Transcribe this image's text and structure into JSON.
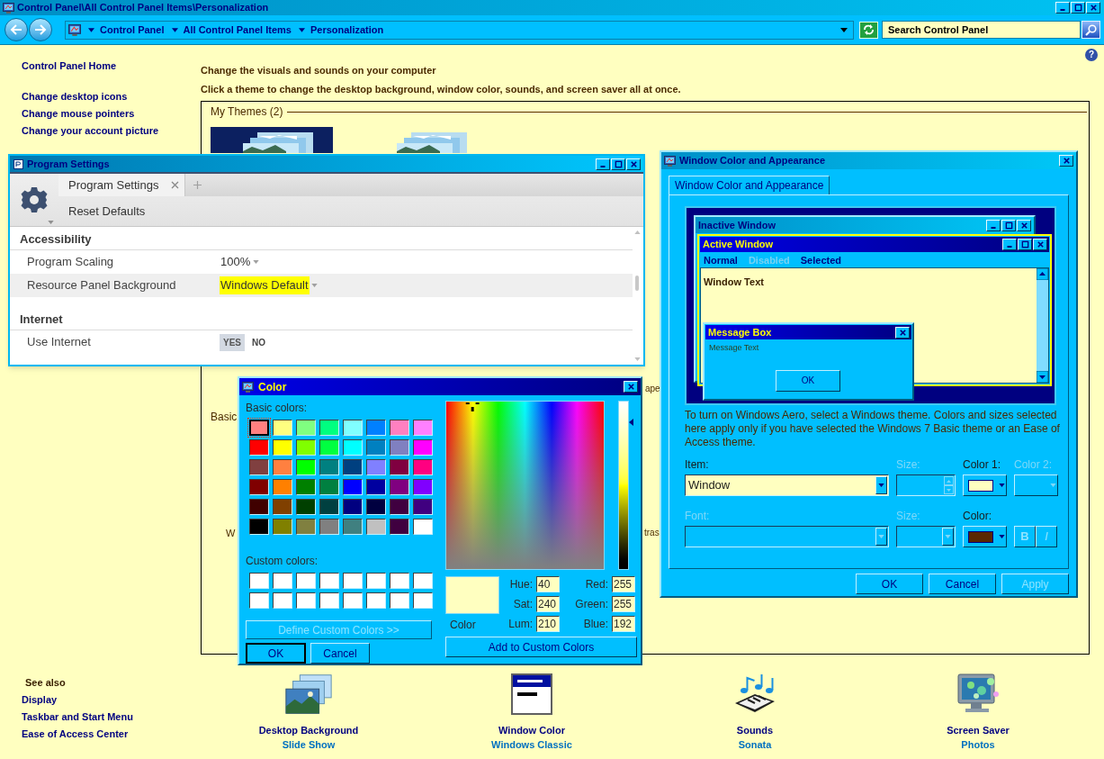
{
  "window": {
    "title": "Control Panel\\All Control Panel Items\\Personalization"
  },
  "address_bar": {
    "breadcrumbs": [
      "Control Panel",
      "All Control Panel Items",
      "Personalization"
    ]
  },
  "search": {
    "placeholder": "Search Control Panel"
  },
  "help": "?",
  "sidebar": {
    "home": "Control Panel Home",
    "links": [
      "Change desktop icons",
      "Change mouse pointers",
      "Change your account picture"
    ],
    "see_also_title": "See also",
    "see_also_links": [
      "Display",
      "Taskbar and Start Menu",
      "Ease of Access Center"
    ]
  },
  "content": {
    "heading": "Change the visuals and sounds on your computer",
    "instructions": "Click a theme to change the desktop background, window color, sounds, and screen saver all at once.",
    "themes_group": "My Themes (2)",
    "partly_hidden_texts": [
      "Basic",
      "W",
      "ape",
      "tras"
    ]
  },
  "settings_bar": [
    {
      "label": "Desktop Background",
      "value": "Slide Show"
    },
    {
      "label": "Window Color",
      "value": "Windows Classic"
    },
    {
      "label": "Sounds",
      "value": "Sonata"
    },
    {
      "label": "Screen Saver",
      "value": "Photos"
    }
  ],
  "program_settings": {
    "title": "Program Settings",
    "tabs": [
      {
        "label": "Program Settings",
        "selected": true
      }
    ],
    "reset": "Reset Defaults",
    "sections": [
      {
        "title": "Accessibility",
        "rows": [
          {
            "kind": "dropdown",
            "label": "Program Scaling",
            "value": "100%",
            "highlighted": false,
            "hovered": false
          },
          {
            "kind": "dropdown",
            "label": "Resource Panel Background",
            "value": "Windows Default",
            "highlighted": true,
            "hovered": true
          }
        ]
      },
      {
        "title": "Internet",
        "rows": [
          {
            "kind": "toggle",
            "label": "Use Internet",
            "hovered": false,
            "options": [
              {
                "label": "YES",
                "selected": true
              },
              {
                "label": "NO",
                "selected": false
              }
            ]
          }
        ]
      }
    ]
  },
  "color_dialog": {
    "title": "Color",
    "basic_label": "Basic colors:",
    "basic_colors": [
      {
        "color": "#ff8080",
        "selected": true
      },
      {
        "color": "#ffff80",
        "selected": false
      },
      {
        "color": "#80ff80",
        "selected": false
      },
      {
        "color": "#00ff80",
        "selected": false
      },
      {
        "color": "#80ffff",
        "selected": false
      },
      {
        "color": "#0080ff",
        "selected": false
      },
      {
        "color": "#ff80c0",
        "selected": false
      },
      {
        "color": "#ff80ff",
        "selected": false
      },
      {
        "color": "#ff0000",
        "selected": false
      },
      {
        "color": "#ffff00",
        "selected": false
      },
      {
        "color": "#80ff00",
        "selected": false
      },
      {
        "color": "#00ff40",
        "selected": false
      },
      {
        "color": "#00ffff",
        "selected": false
      },
      {
        "color": "#0080c0",
        "selected": false
      },
      {
        "color": "#8080c0",
        "selected": false
      },
      {
        "color": "#ff00ff",
        "selected": false
      },
      {
        "color": "#804040",
        "selected": false
      },
      {
        "color": "#ff8040",
        "selected": false
      },
      {
        "color": "#00ff00",
        "selected": false
      },
      {
        "color": "#008080",
        "selected": false
      },
      {
        "color": "#004080",
        "selected": false
      },
      {
        "color": "#8080ff",
        "selected": false
      },
      {
        "color": "#800040",
        "selected": false
      },
      {
        "color": "#ff0080",
        "selected": false
      },
      {
        "color": "#800000",
        "selected": false
      },
      {
        "color": "#ff8000",
        "selected": false
      },
      {
        "color": "#008000",
        "selected": false
      },
      {
        "color": "#008040",
        "selected": false
      },
      {
        "color": "#0000ff",
        "selected": false
      },
      {
        "color": "#0000a0",
        "selected": false
      },
      {
        "color": "#800080",
        "selected": false
      },
      {
        "color": "#8000ff",
        "selected": false
      },
      {
        "color": "#400000",
        "selected": false
      },
      {
        "color": "#804000",
        "selected": false
      },
      {
        "color": "#004000",
        "selected": false
      },
      {
        "color": "#004040",
        "selected": false
      },
      {
        "color": "#000080",
        "selected": false
      },
      {
        "color": "#000040",
        "selected": false
      },
      {
        "color": "#400040",
        "selected": false
      },
      {
        "color": "#400080",
        "selected": false
      },
      {
        "color": "#000000",
        "selected": false
      },
      {
        "color": "#808000",
        "selected": false
      },
      {
        "color": "#808040",
        "selected": false
      },
      {
        "color": "#808080",
        "selected": false
      },
      {
        "color": "#408080",
        "selected": false
      },
      {
        "color": "#c0c0c0",
        "selected": false
      },
      {
        "color": "#400040",
        "selected": false
      },
      {
        "color": "#ffffff",
        "selected": false
      }
    ],
    "custom_label": "Custom colors:",
    "custom_colors": [
      {
        "color": "#ffffff"
      },
      {
        "color": "#ffffff"
      },
      {
        "color": "#ffffff"
      },
      {
        "color": "#ffffff"
      },
      {
        "color": "#ffffff"
      },
      {
        "color": "#ffffff"
      },
      {
        "color": "#ffffff"
      },
      {
        "color": "#ffffff"
      },
      {
        "color": "#ffffff"
      },
      {
        "color": "#ffffff"
      },
      {
        "color": "#ffffff"
      },
      {
        "color": "#ffffff"
      },
      {
        "color": "#ffffff"
      },
      {
        "color": "#ffffff"
      },
      {
        "color": "#ffffff"
      },
      {
        "color": "#ffffff"
      }
    ],
    "define_button": {
      "label": "Define Custom Colors >>",
      "disabled": true
    },
    "ok": "OK",
    "cancel": "Cancel",
    "luminance_slider": {
      "level": 0.875
    },
    "preview": {
      "color": "#ffffc0",
      "label": "Color"
    },
    "fields": [
      {
        "label": "Hue:",
        "value": "40"
      },
      {
        "label": "Red:",
        "value": "255"
      },
      {
        "label": "Sat:",
        "value": "240"
      },
      {
        "label": "Green:",
        "value": "255"
      },
      {
        "label": "Lum:",
        "value": "210"
      },
      {
        "label": "Blue:",
        "value": "192"
      }
    ],
    "add_button": "Add to Custom Colors"
  },
  "appearance_dialog": {
    "title": "Window Color and Appearance",
    "tabs": [
      {
        "label": "Window Color and Appearance",
        "selected": true
      }
    ],
    "preview": {
      "inactive_title": "Inactive Window",
      "active_title": "Active Window",
      "menu": [
        {
          "label": "Normal",
          "disabled": false
        },
        {
          "label": "Disabled",
          "disabled": true
        },
        {
          "label": "Selected",
          "disabled": false
        }
      ],
      "window_text": "Window Text",
      "message_title": "Message Box",
      "message_text": "Message Text",
      "message_ok": "OK"
    },
    "description": "To turn on Windows Aero, select a Windows theme.  Colors and sizes selected here apply only if you have selected the Windows 7 Basic theme or an Ease of Access theme.",
    "controls": [
      {
        "kind": "select",
        "label": "Item:",
        "value": "Window",
        "disabled": false
      },
      {
        "kind": "spinner",
        "label": "Size:",
        "disabled": true
      },
      {
        "kind": "color",
        "label": "Color 1:",
        "color": "#ffffc0",
        "disabled": false
      },
      {
        "kind": "color",
        "label": "Color 2:",
        "disabled": true
      },
      {
        "kind": "select",
        "label": "Font:",
        "disabled": true
      },
      {
        "kind": "select",
        "label": "Size:",
        "disabled": true
      },
      {
        "kind": "color",
        "label": "Color:",
        "color": "#5a2800",
        "disabled": false
      },
      {
        "kind": "style_buttons",
        "buttons": [
          "B",
          "I"
        ],
        "disabled": true
      }
    ],
    "buttons": [
      {
        "label": "OK",
        "disabled": false
      },
      {
        "label": "Cancel",
        "disabled": false
      },
      {
        "label": "Apply",
        "disabled": true
      }
    ]
  }
}
